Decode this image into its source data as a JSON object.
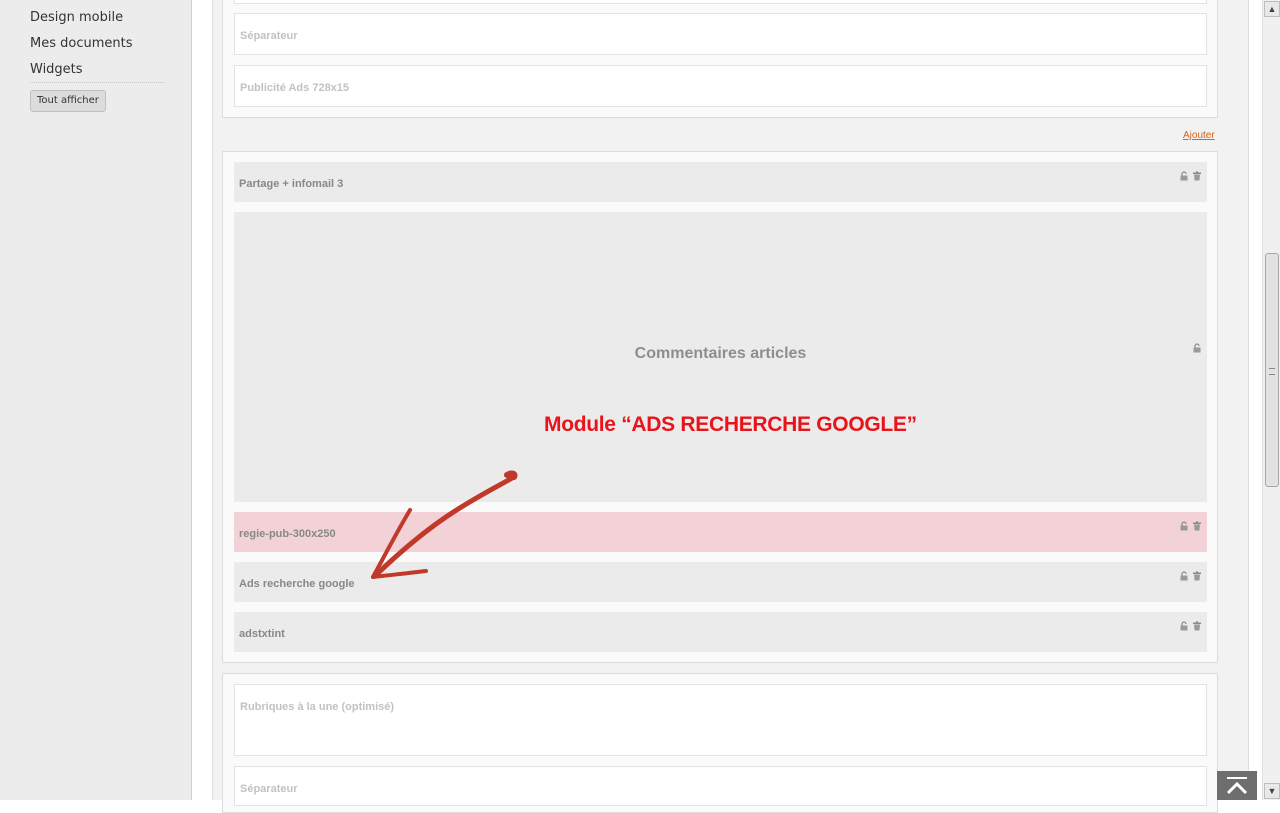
{
  "sidebar": {
    "items": [
      {
        "label": "Design mobile"
      },
      {
        "label": "Mes documents"
      },
      {
        "label": "Widgets"
      }
    ],
    "show_all_label": "Tout afficher"
  },
  "zones": [
    {
      "modules": [
        {
          "title": "Séparateur",
          "state": "empty"
        },
        {
          "title": "Publicité Ads 728x15",
          "state": "empty"
        }
      ]
    },
    {
      "add_label": "Ajouter",
      "modules": [
        {
          "title": "Partage + infomail 3",
          "icons": [
            "lock-icon",
            "trash-icon"
          ]
        },
        {
          "title": "Commentaires articles",
          "icons": [
            "lock-icon"
          ]
        },
        {
          "title": "regie-pub-300x250",
          "icons": [
            "lock-icon",
            "trash-icon"
          ],
          "highlight": "#f2d2d6"
        },
        {
          "title": "Ads recherche google",
          "icons": [
            "lock-icon",
            "trash-icon"
          ]
        },
        {
          "title": "adstxtint",
          "icons": [
            "lock-icon",
            "trash-icon"
          ]
        }
      ]
    },
    {
      "modules": [
        {
          "title": "Rubriques à la une (optimisé)",
          "state": "empty"
        },
        {
          "title": "Séparateur",
          "state": "empty"
        }
      ]
    }
  ],
  "annotation": {
    "text": "Module “ADS RECHERCHE GOOGLE”",
    "color": "#e8141b",
    "arrow_color": "#c0392b"
  },
  "colors": {
    "accent_link": "#d0661a",
    "module_grey": "#ebebeb",
    "page_bg": "#f2f2f2"
  },
  "scrollbar": {
    "up_icon": "scroll-up-arrow-icon",
    "down_icon": "scroll-down-arrow-icon"
  },
  "back_to_top_icon": "chevron-up-icon"
}
